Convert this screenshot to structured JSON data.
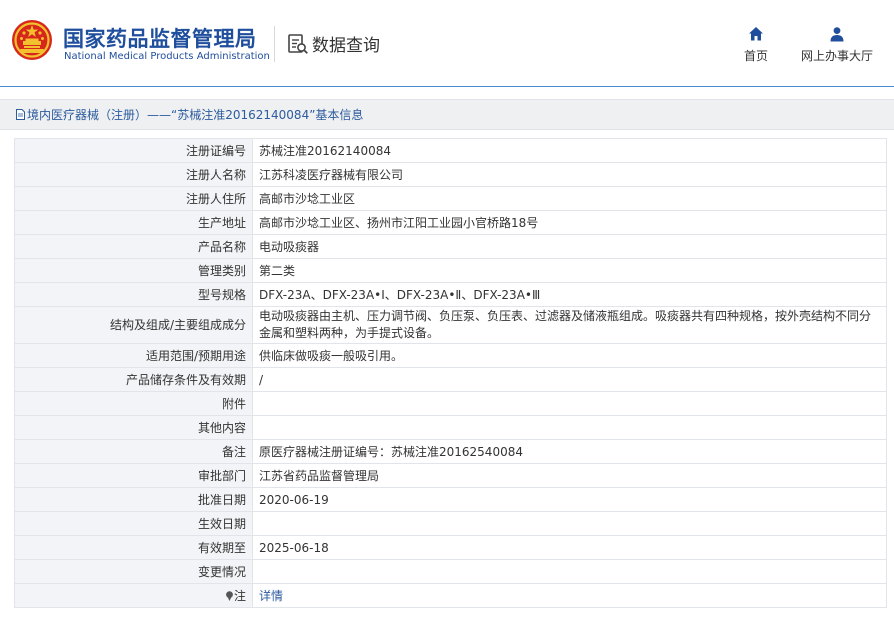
{
  "header": {
    "brand_cn": "国家药品监督管理局",
    "brand_en": "National Medical Products Administration",
    "query_label": "数据查询",
    "nav": [
      {
        "label": "首页",
        "icon": "home-icon"
      },
      {
        "label": "网上办事大厅",
        "icon": "user-icon"
      }
    ]
  },
  "breadcrumb": {
    "icon": "document-icon",
    "text": "境内医疗器械（注册）——“苏械注准20162140084”基本信息"
  },
  "colors": {
    "brand_blue": "#1f4e9c",
    "link_blue": "#2c5b9e",
    "label_bg": "#f2f4f7",
    "emblem_red": "#d7261b",
    "emblem_gold": "#f3c12d"
  },
  "rows": [
    {
      "label": "注册证编号",
      "value": "苏械注准20162140084"
    },
    {
      "label": "注册人名称",
      "value": "江苏科凌医疗器械有限公司"
    },
    {
      "label": "注册人住所",
      "value": "高邮市沙埝工业区"
    },
    {
      "label": "生产地址",
      "value": "高邮市沙埝工业区、扬州市江阳工业园小官桥路18号"
    },
    {
      "label": "产品名称",
      "value": "电动吸痰器"
    },
    {
      "label": "管理类别",
      "value": "第二类"
    },
    {
      "label": "型号规格",
      "value": "DFX-23A、DFX-23A•Ⅰ、DFX-23A•Ⅱ、DFX-23A•Ⅲ"
    },
    {
      "label": "结构及组成/主要组成成分",
      "value": "电动吸痰器由主机、压力调节阀、负压泵、负压表、过滤器及储液瓶组成。吸痰器共有四种规格，按外壳结构不同分金属和塑料两种，为手提式设备。"
    },
    {
      "label": "适用范围/预期用途",
      "value": "供临床做吸痰一般吸引用。"
    },
    {
      "label": "产品储存条件及有效期",
      "value": "/"
    },
    {
      "label": "附件",
      "value": ""
    },
    {
      "label": "其他内容",
      "value": ""
    },
    {
      "label": "备注",
      "value": "原医疗器械注册证编号：苏械注准20162540084"
    },
    {
      "label": "审批部门",
      "value": "江苏省药品监督管理局"
    },
    {
      "label": "批准日期",
      "value": "2020-06-19"
    },
    {
      "label": "生效日期",
      "value": ""
    },
    {
      "label": "有效期至",
      "value": "2025-06-18"
    },
    {
      "label": "变更情况",
      "value": ""
    },
    {
      "label": "注",
      "value": "详情",
      "label_icon": "pin-icon"
    }
  ]
}
